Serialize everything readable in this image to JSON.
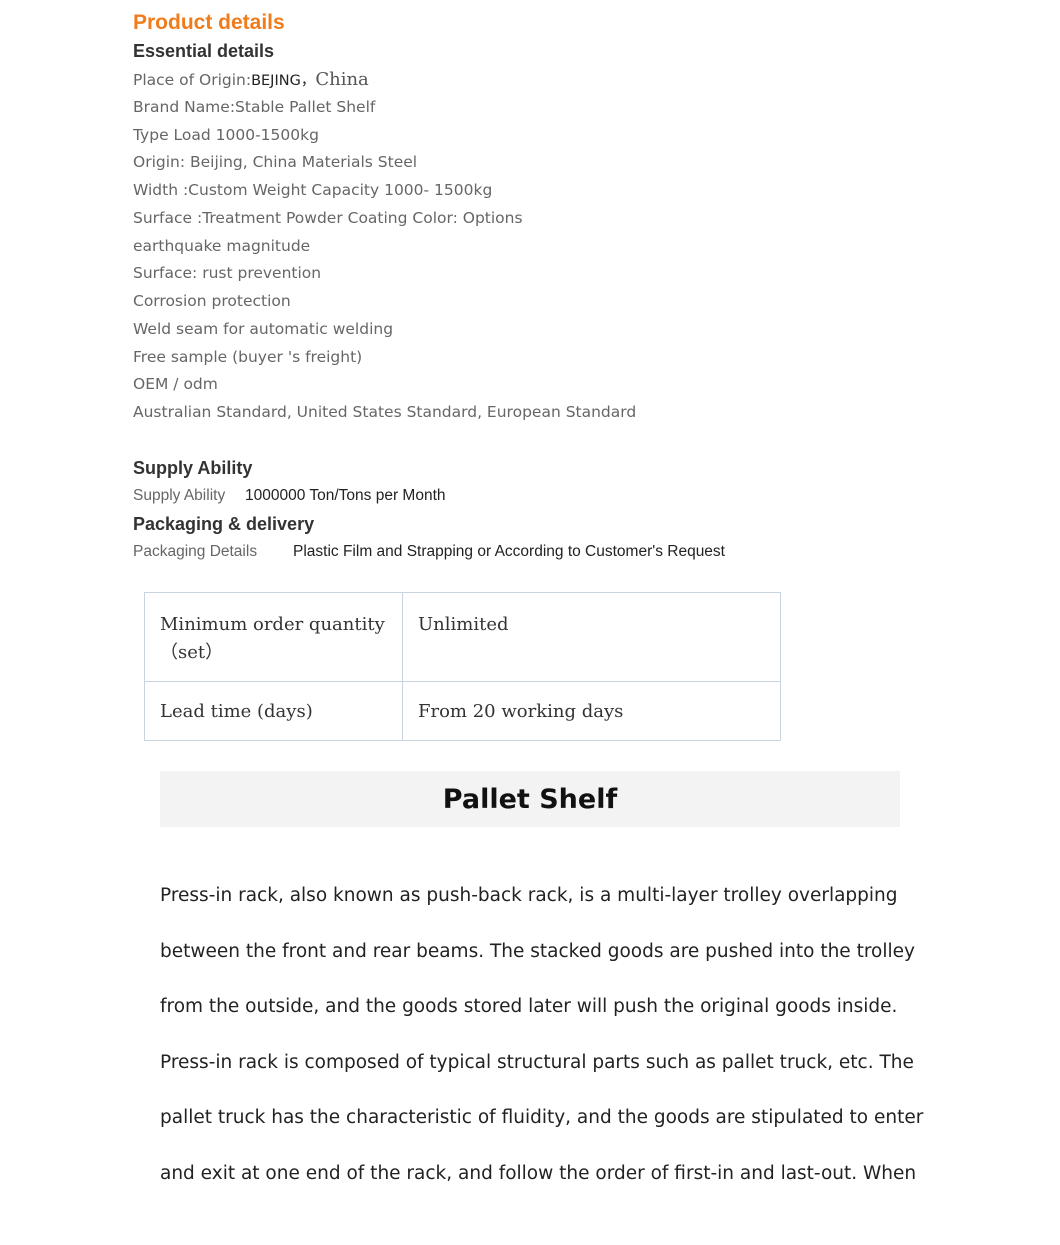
{
  "header": {
    "title": "Product details",
    "essential_heading": "Essential details"
  },
  "essential_details": {
    "origin_label": "Place of Origin:",
    "origin_city": "BEJING，",
    "origin_country": "China",
    "lines": [
      "Brand Name:Stable Pallet Shelf",
      "Type Load 1000-1500kg",
      "Origin: Beijing, China Materials Steel",
      "Width :Custom Weight Capacity 1000- 1500kg",
      "Surface :Treatment Powder Coating Color: Options",
      "earthquake magnitude",
      "Surface: rust prevention",
      "Corrosion protection",
      "Weld seam for automatic welding",
      "Free sample (buyer 's freight)",
      "OEM / odm",
      "Australian Standard, United States Standard, European Standard"
    ]
  },
  "supply": {
    "heading": "Supply Ability",
    "label": "Supply Ability",
    "value": "1000000 Ton/Tons per Month"
  },
  "packaging": {
    "heading": "Packaging & delivery",
    "label": "Packaging Details",
    "value": "Plastic Film and Strapping or According to Customer's Request"
  },
  "spec_table": {
    "rows": [
      {
        "key": "Minimum order quantity （set）",
        "value": "Unlimited"
      },
      {
        "key": "Lead time (days)",
        "value": "From 20 working days"
      }
    ]
  },
  "banner": {
    "title": "Pallet Shelf"
  },
  "description": {
    "lines": [
      "Press-in rack, also known as push-back rack, is a multi-layer trolley overlapping",
      "between the front and rear beams. The stacked goods are pushed into the trolley",
      "from the outside, and the goods stored later will push the original goods inside.",
      "Press-in rack is composed of typical structural parts such as pallet truck, etc. The",
      "pallet truck has the characteristic of fluidity, and the goods are stipulated to enter",
      "and exit at one end of the rack, and follow the order of first-in and last-out. When"
    ]
  }
}
